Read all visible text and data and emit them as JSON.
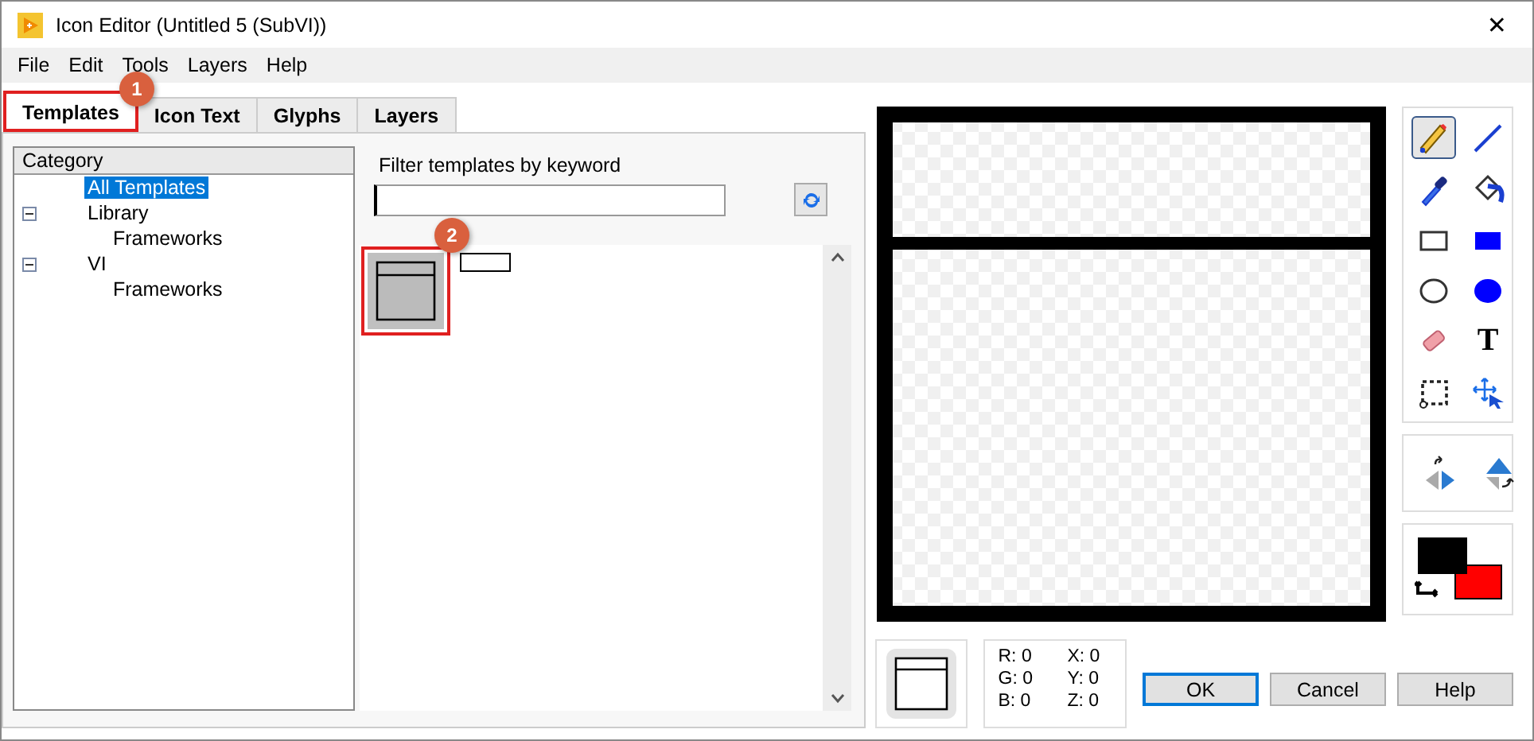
{
  "window": {
    "title": "Icon Editor (Untitled 5 (SubVI))",
    "close": "✕"
  },
  "menu": [
    "File",
    "Edit",
    "Tools",
    "Layers",
    "Help"
  ],
  "tabs": [
    {
      "label": "Templates",
      "selected": true,
      "highlighted": true,
      "callout": "1"
    },
    {
      "label": "Icon Text",
      "selected": false,
      "highlighted": false
    },
    {
      "label": "Glyphs",
      "selected": false,
      "highlighted": false
    },
    {
      "label": "Layers",
      "selected": false,
      "highlighted": false
    }
  ],
  "category": {
    "header": "Category",
    "items": [
      {
        "label": "All Templates",
        "selected": true
      },
      {
        "label": "Library",
        "selected": false,
        "expanded": true,
        "children": [
          {
            "label": "Frameworks",
            "selected": false
          }
        ]
      },
      {
        "label": "VI",
        "selected": false,
        "expanded": true,
        "children": [
          {
            "label": "Frameworks",
            "selected": false
          }
        ]
      }
    ]
  },
  "filter": {
    "label": "Filter templates by keyword"
  },
  "templates": [
    {
      "kind": "banner",
      "highlighted": true,
      "callout": "2"
    },
    {
      "kind": "strip",
      "highlighted": false
    }
  ],
  "tools": [
    {
      "kind": "pencil",
      "selected": true
    },
    {
      "kind": "line",
      "selected": false
    },
    {
      "kind": "dropper",
      "selected": false
    },
    {
      "kind": "bucket",
      "selected": false
    },
    {
      "kind": "rect",
      "selected": false
    },
    {
      "kind": "filled-rect",
      "selected": false
    },
    {
      "kind": "ellipse",
      "selected": false
    },
    {
      "kind": "filled-ellipse",
      "selected": false
    },
    {
      "kind": "eraser",
      "selected": false
    },
    {
      "kind": "text",
      "selected": false,
      "glyph": "T"
    },
    {
      "kind": "select",
      "selected": false
    },
    {
      "kind": "move",
      "selected": false
    }
  ],
  "flip_tools": [
    {
      "kind": "flip-horizontal"
    },
    {
      "kind": "flip-vertical"
    }
  ],
  "swatches": [
    {
      "kind": "background",
      "color": "#ff0000"
    },
    {
      "kind": "foreground",
      "color": "#000000"
    }
  ],
  "readout": [
    "R: 0",
    "G: 0",
    "B: 0",
    "X: 0",
    "Y: 0",
    "Z: 0"
  ],
  "buttons": [
    {
      "label": "OK",
      "default": true
    },
    {
      "label": "Cancel",
      "default": false
    },
    {
      "label": "Help",
      "default": false
    }
  ]
}
